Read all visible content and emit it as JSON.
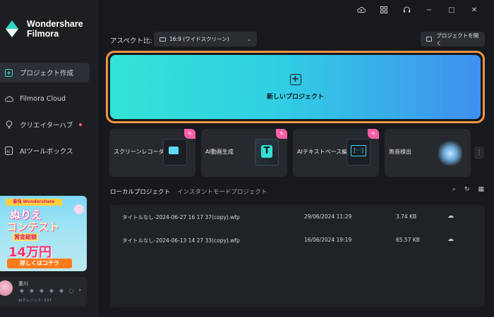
{
  "app": {
    "logo_line1": "Wondershare",
    "logo_line2": "Filmora"
  },
  "window_controls": {
    "icons": [
      "cloud-sync-icon",
      "grid-icon",
      "headset-icon",
      "minimize-icon",
      "maximize-icon",
      "close-icon"
    ],
    "minimize": "−",
    "maximize": "□",
    "close": "✕"
  },
  "sidebar": {
    "items": [
      {
        "label": "プロジェクト作成",
        "icon": "plus-square-icon",
        "active": true
      },
      {
        "label": "Filmora Cloud",
        "icon": "cloud-icon",
        "active": false
      },
      {
        "label": "クリエイターハブ",
        "icon": "lightbulb-icon",
        "active": false,
        "dot": true
      },
      {
        "label": "AIツールボックス",
        "icon": "ai-box-icon",
        "active": false
      }
    ],
    "promo": {
      "banner": "最強 Wondershare",
      "line1": "ぬりえ",
      "line2": "コンテスト",
      "line3": "賞金総額",
      "line4": "14万円",
      "cta": "詳しくはコチラ"
    },
    "user": {
      "name": "菫川",
      "credits": "AIクレジット: 537",
      "chevron": "›"
    }
  },
  "header": {
    "aspect_label": "アスペクト比:",
    "aspect_value": "16:9 (ワイドスクリーン)",
    "aspect_caret": "⌄",
    "open_project": "プロジェクトを開く"
  },
  "new_project": {
    "plus": "+",
    "label": "新しいプロジェクト"
  },
  "tools": [
    {
      "label": "スクリーンレコーダー",
      "art": "recorder",
      "badge": true
    },
    {
      "label": "AI動画生成",
      "art": "ai-video",
      "badge": true
    },
    {
      "label": "AIテキストベース編集",
      "art": "text-edit",
      "badge": true
    },
    {
      "label": "無音検出",
      "art": "silence",
      "badge": false
    }
  ],
  "tool_art": {
    "ai_video_letter": "T",
    "text_edit_glyph": "[···]"
  },
  "more": "⋮",
  "badge_glyph": "✎",
  "project_tabs": [
    {
      "label": "ローカルプロジェクト",
      "active": true
    },
    {
      "label": "インスタントモードプロジェクト",
      "active": false
    }
  ],
  "list_tools": {
    "search": "⌕",
    "refresh": "↻",
    "view": "▦"
  },
  "projects": [
    {
      "name": "タイトルなし-2024-06-27 16 17 37(copy).wfp",
      "date": "29/06/2024 11:29",
      "size": "3.74 KB",
      "cloud": "☁"
    },
    {
      "name": "タイトルなし-2024-06-13 14 27 33(copy).wfp",
      "date": "16/06/2024 19:19",
      "size": "65.57 KB",
      "cloud": "☁"
    }
  ],
  "colors": {
    "accent_outline": "#f29446",
    "gradient_start": "#33e3d6",
    "gradient_end": "#3f8ff0",
    "badge": "#ff5fa8"
  }
}
